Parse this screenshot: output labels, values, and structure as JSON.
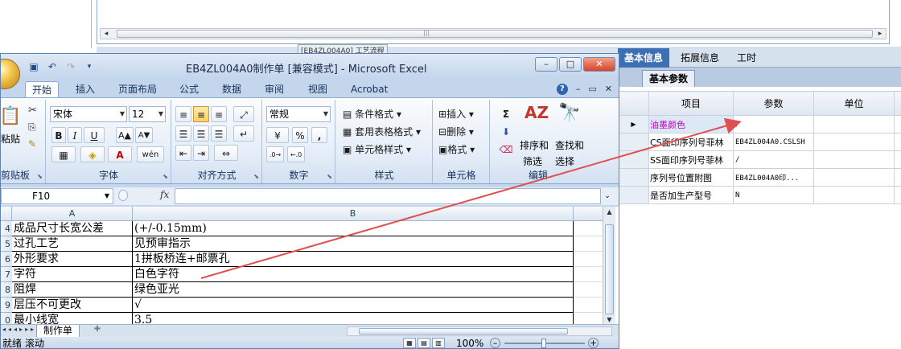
{
  "background_app": {
    "scroll_left": "◂",
    "scroll_right": "▸",
    "scroll_grip": "|||",
    "tab_strip_label": "[EB4ZL004A0] 工艺流程"
  },
  "right_panel": {
    "tabs": [
      "基本信息",
      "拓展信息",
      "工时"
    ],
    "active_tab": "基本信息",
    "sub_tab": "基本参数",
    "columns": [
      "项目",
      "参数",
      "单位"
    ],
    "rows": [
      {
        "indicator": "▶",
        "name": "油墨颜色",
        "value": "/",
        "unit": ""
      },
      {
        "indicator": "",
        "name": "CS面印序列号菲林",
        "value": "EB4ZL004A0.CSLSH",
        "unit": ""
      },
      {
        "indicator": "",
        "name": "SS面印序列号菲林",
        "value": "/",
        "unit": ""
      },
      {
        "indicator": "",
        "name": "序列号位置附图",
        "value": "EB4ZL004A0印...",
        "unit": ""
      },
      {
        "indicator": "",
        "name": "是否加生产型号",
        "value": "N",
        "unit": ""
      }
    ]
  },
  "excel": {
    "title": "EB4ZL004A0制作单 [兼容模式] - Microsoft Excel",
    "window_buttons": {
      "minimize": "–",
      "maximize": "□",
      "close": "✕"
    },
    "ribbon_tabs": [
      "开始",
      "插入",
      "页面布局",
      "公式",
      "数据",
      "审阅",
      "视图",
      "Acrobat"
    ],
    "active_ribbon_tab": "开始",
    "ribbon_right": {
      "help": "?",
      "min": "–",
      "restore": "▭",
      "close": "✕"
    },
    "groups": {
      "clipboard": {
        "label": "剪贴板",
        "paste": "粘贴"
      },
      "font": {
        "label": "字体",
        "font_name": "宋体",
        "font_size": "12",
        "bold": "B",
        "italic": "I",
        "underline": "U",
        "grow": "A▲",
        "shrink": "A▼",
        "wen": "wén"
      },
      "alignment": {
        "label": "对齐方式"
      },
      "number": {
        "label": "数字",
        "format": "常规",
        "percent": "%",
        "comma": ","
      },
      "styles": {
        "label": "样式",
        "conditional": "条件格式",
        "table": "套用表格格式",
        "cell": "单元格样式"
      },
      "cells": {
        "label": "单元格",
        "insert": "插入",
        "delete": "删除",
        "format": "格式"
      },
      "editing": {
        "label": "编辑",
        "sort": "排序和",
        "filter": "筛选",
        "find": "查找和",
        "select": "选择",
        "sigma": "Σ"
      }
    },
    "formula_bar": {
      "name_box": "F10",
      "fx": "fx",
      "formula": ""
    },
    "columns": [
      "A",
      "B"
    ],
    "rows": [
      {
        "num": "4",
        "a": "成品尺寸长宽公差",
        "b": "(+/-0.15mm)"
      },
      {
        "num": "5",
        "a": "过孔工艺",
        "b": "见预审指示"
      },
      {
        "num": "6",
        "a": "外形要求",
        "b": "1拼板桥连+邮票孔"
      },
      {
        "num": "7",
        "a": "字符",
        "b": "白色字符"
      },
      {
        "num": "8",
        "a": "阻焊",
        "b": "绿色亚光"
      },
      {
        "num": "9",
        "a": "层压不可更改",
        "b": "√"
      },
      {
        "num": "0",
        "a": "最小线宽",
        "b": "3.5"
      }
    ],
    "sheet_tab": "制作单",
    "status": {
      "left": "就绪",
      "mode": "滚动",
      "zoom": "100%"
    }
  },
  "colors": {
    "annotation_arrow": "#e05050",
    "highlight_name": "#c000c0",
    "active_tab": "#3c6fb3"
  }
}
